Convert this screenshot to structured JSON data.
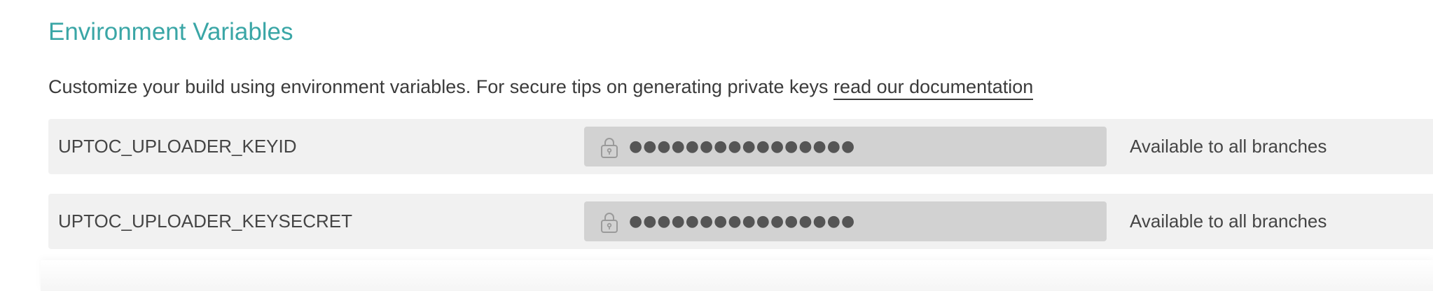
{
  "section": {
    "title": "Environment Variables",
    "description_prefix": "Customize your build using environment variables. For secure tips on generating private keys ",
    "documentation_link": "read our documentation"
  },
  "env_vars": [
    {
      "name": "UPTOC_UPLOADER_KEYID",
      "masked_value": "●●●●●●●●●●●●●●●●",
      "icon": "lock-icon",
      "availability": "Available to all branches"
    },
    {
      "name": "UPTOC_UPLOADER_KEYSECRET",
      "masked_value": "●●●●●●●●●●●●●●●●",
      "icon": "lock-icon",
      "availability": "Available to all branches"
    }
  ],
  "colors": {
    "title": "#3aa6a6",
    "row_background": "#f1f1f1",
    "value_field_background": "#d2d2d2",
    "text": "#3f3f3f"
  }
}
